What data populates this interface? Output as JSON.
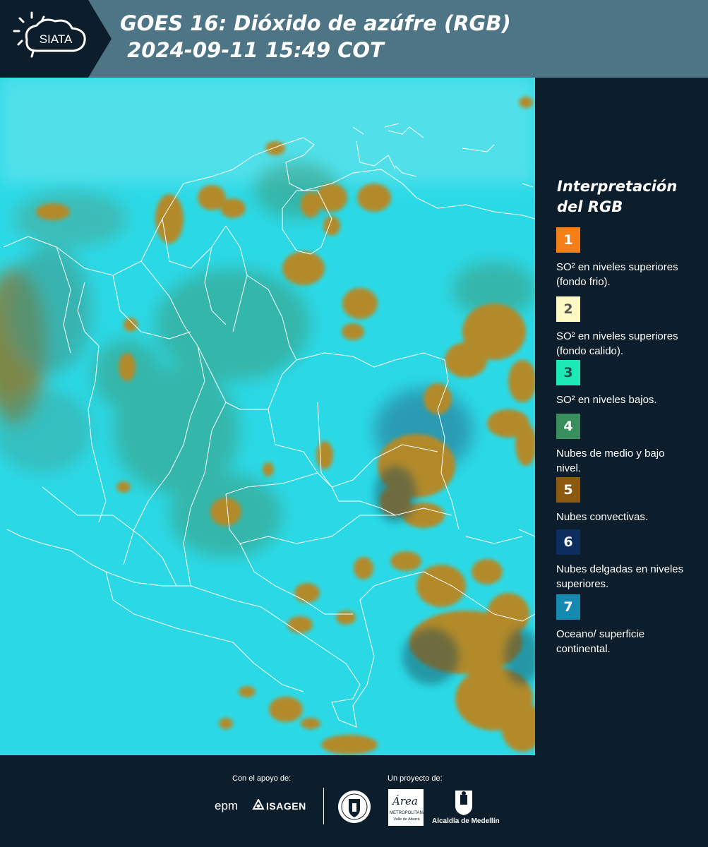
{
  "header": {
    "logo_text": "SIATA",
    "title": "GOES 16: Dióxido de azúfre (RGB)\n 2024-09-11 15:49 COT"
  },
  "legend": {
    "title": "Interpretación del RGB",
    "items": [
      {
        "number": "1",
        "label": "SO² en niveles superiores (fondo frio).",
        "color": "#f57f17"
      },
      {
        "number": "2",
        "label": "SO² en niveles superiores (fondo calido).",
        "color": "#fff9c4"
      },
      {
        "number": "3",
        "label": "SO² en niveles bajos.",
        "color": "#1de9b6"
      },
      {
        "number": "4",
        "label": "Nubes de medio y bajo nivel.",
        "color": "#388e5c"
      },
      {
        "number": "5",
        "label": "Nubes convectivas.",
        "color": "#8b5a0e"
      },
      {
        "number": "6",
        "label": "Nubes delgadas en niveles superiores.",
        "color": "#0d2d5e"
      },
      {
        "number": "7",
        "label": "Oceano/ superficie continental.",
        "color": "#1589b0"
      }
    ]
  },
  "footer": {
    "support_label": "Con el apoyo de:",
    "project_label": "Un proyecto de:",
    "epm": "epm",
    "isagen": "ISAGEN",
    "area_name": "Área",
    "area_sub": "METROPOLITANA",
    "area_sub2": "Valle de Aburrá",
    "alcaldia": "Alcaldía de Medellín"
  }
}
